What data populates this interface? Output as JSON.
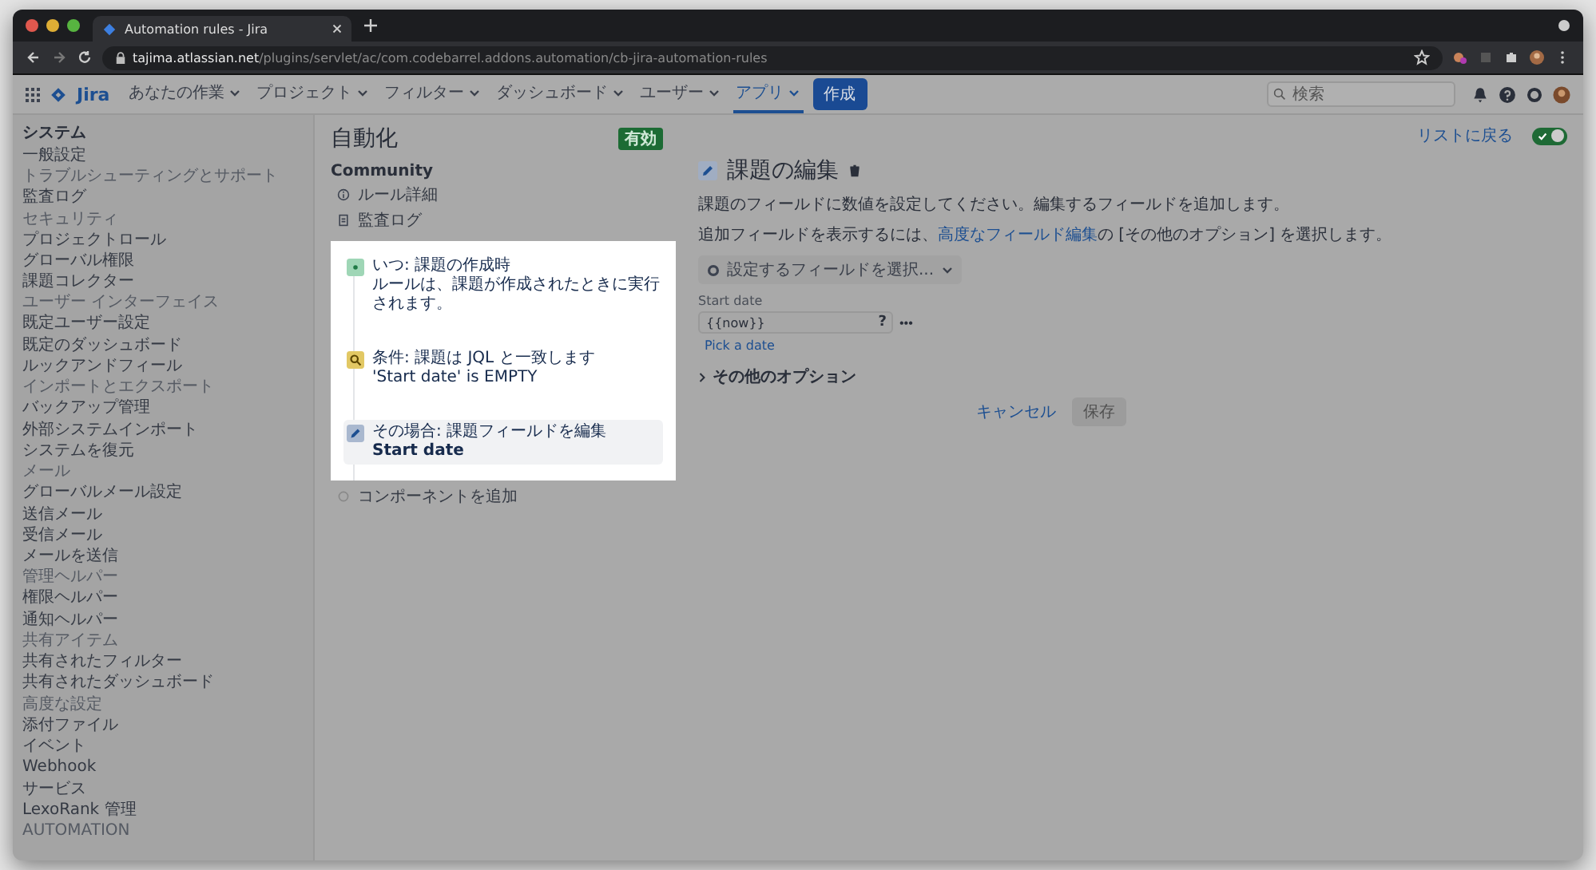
{
  "browser": {
    "tab_title": "Automation rules - Jira",
    "url_host": "tajima.atlassian.net",
    "url_path": "/plugins/servlet/ac/com.codebarrel.addons.automation/cb-jira-automation-rules"
  },
  "nav": {
    "items": [
      {
        "label": "あなたの作業",
        "selected": false
      },
      {
        "label": "プロジェクト",
        "selected": false
      },
      {
        "label": "フィルター",
        "selected": false
      },
      {
        "label": "ダッシュボード",
        "selected": false
      },
      {
        "label": "ユーザー",
        "selected": false
      },
      {
        "label": "アプリ",
        "selected": true
      }
    ],
    "create": "作成",
    "search_placeholder": "検索",
    "logo": "Jira"
  },
  "sidebar": {
    "title": "システム",
    "sections": [
      {
        "items": [
          "一般設定"
        ]
      },
      {
        "heading": "トラブルシューティングとサポート",
        "items": [
          "監査ログ"
        ]
      },
      {
        "heading": "セキュリティ",
        "items": [
          "プロジェクトロール",
          "グローバル権限",
          "課題コレクター"
        ]
      },
      {
        "heading": "ユーザー インターフェイス",
        "items": [
          "既定ユーザー設定",
          "既定のダッシュボード",
          "ルックアンドフィール"
        ]
      },
      {
        "heading": "インポートとエクスポート",
        "items": [
          "バックアップ管理",
          "外部システムインポート",
          "システムを復元"
        ]
      },
      {
        "heading": "メール",
        "items": [
          "グローバルメール設定",
          "送信メール",
          "受信メール",
          "メールを送信"
        ]
      },
      {
        "heading": "管理ヘルパー",
        "items": [
          "権限ヘルパー",
          "通知ヘルパー"
        ]
      },
      {
        "heading": "共有アイテム",
        "items": [
          "共有されたフィルター",
          "共有されたダッシュボード"
        ]
      },
      {
        "heading": "高度な設定",
        "items": [
          "添付ファイル",
          "イベント",
          "Webhook",
          "サービス",
          "LexoRank 管理"
        ]
      },
      {
        "heading": "AUTOMATION"
      }
    ]
  },
  "rule": {
    "title": "自動化",
    "badge": "有効",
    "group": "Community",
    "links": [
      {
        "kind": "info",
        "label": "ルール詳細"
      },
      {
        "kind": "log",
        "label": "監査ログ"
      }
    ],
    "steps": [
      {
        "kind": "trigger",
        "title": "いつ: 課題の作成時",
        "detail": "ルールは、課題が作成されたときに実行されます。",
        "selected": false
      },
      {
        "kind": "condition",
        "title": "条件: 課題は JQL と一致します",
        "detail": "'Start date' is EMPTY",
        "selected": false
      },
      {
        "kind": "action",
        "title": "その場合: 課題フィールドを編集",
        "detail": "Start date",
        "selected": true
      }
    ],
    "add_component": "コンポーネントを追加"
  },
  "editor": {
    "back_link": "リストに戻る",
    "toggle": {
      "on": true
    },
    "title": "課題の編集",
    "description": "課題のフィールドに数値を設定してください。編集するフィールドを追加します。",
    "hint_before": "追加フィールドを表示するには、",
    "hint_link": "高度なフィールド編集",
    "hint_after": "の [その他のオプション] を選択します。",
    "field_picker": "設定するフィールドを選択...",
    "field": {
      "label": "Start date",
      "value": "{{now}}",
      "help": "?",
      "more": "•••",
      "pick": "Pick a date"
    },
    "more_options": "その他のオプション",
    "cancel": "キャンセル",
    "save": {
      "label": "保存",
      "disabled": true
    }
  }
}
